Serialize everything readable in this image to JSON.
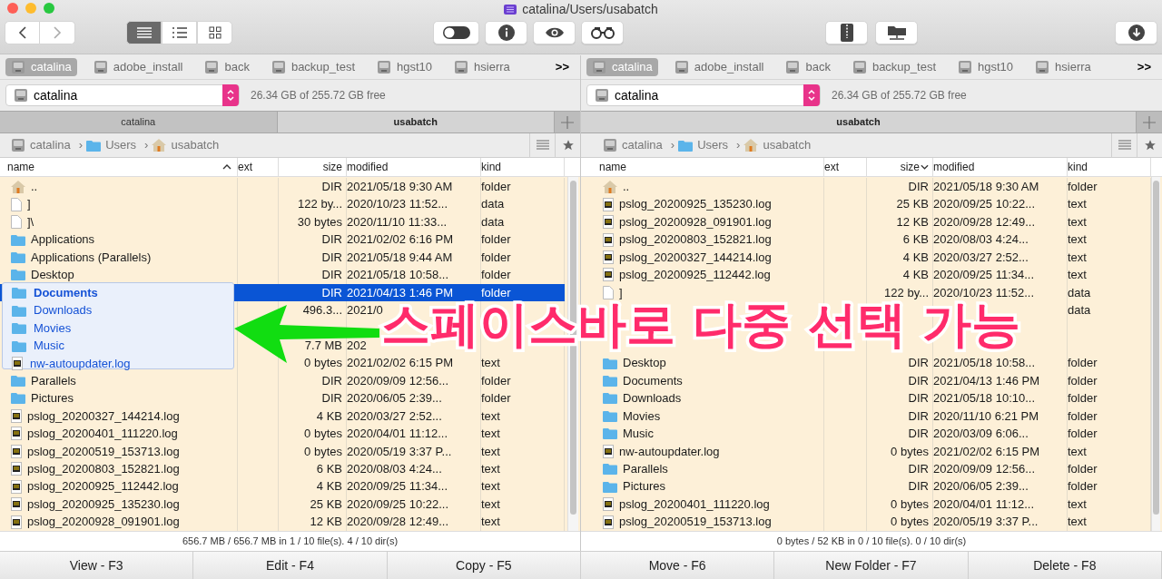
{
  "window": {
    "title": "catalina/Users/usabatch"
  },
  "toolbar": {
    "view_modes": [
      {
        "kind": "list",
        "selected": true
      },
      {
        "kind": "detail",
        "selected": false
      },
      {
        "kind": "grid",
        "selected": false
      }
    ]
  },
  "panes": [
    {
      "volumes": [
        {
          "label": "catalina",
          "selected": true
        },
        {
          "label": "adobe_install",
          "selected": false
        },
        {
          "label": "back",
          "selected": false
        },
        {
          "label": "backup_test",
          "selected": false
        },
        {
          "label": "hgst10",
          "selected": false
        },
        {
          "label": "hsierra",
          "selected": false
        }
      ],
      "volumes_more": ">>",
      "drive": "catalina",
      "free": "26.34 GB of 255.72 GB free",
      "tabs": [
        {
          "label": "catalina",
          "selected": false
        },
        {
          "label": "usabatch",
          "selected": true
        }
      ],
      "path": [
        {
          "kind": "disk",
          "label": "catalina"
        },
        {
          "kind": "folder",
          "label": "Users"
        },
        {
          "kind": "home",
          "label": "usabatch"
        }
      ],
      "separator": "›",
      "columns": [
        {
          "label": "name",
          "sorted": true,
          "descending": false
        },
        {
          "label": "ext"
        },
        {
          "label": "size"
        },
        {
          "label": "modified"
        },
        {
          "label": "kind"
        }
      ],
      "rows": [
        {
          "kind": "home",
          "name": "..",
          "size": "DIR",
          "modified": "2021/05/18 9:30 AM",
          "type": "folder",
          "selected": false
        },
        {
          "kind": "file",
          "name": "]",
          "size": "122 by...",
          "modified": "2020/10/23 11:52...",
          "type": "data",
          "selected": false
        },
        {
          "kind": "file",
          "name": "]\\",
          "size": "30 bytes",
          "modified": "2020/11/10 11:33...",
          "type": "data",
          "selected": false
        },
        {
          "kind": "folder",
          "name": "Applications",
          "size": "DIR",
          "modified": "2021/02/02 6:16 PM",
          "type": "folder",
          "selected": false
        },
        {
          "kind": "folder",
          "name": "Applications (Parallels)",
          "size": "DIR",
          "modified": "2021/05/18 9:44 AM",
          "type": "folder",
          "selected": false
        },
        {
          "kind": "folder",
          "name": "Desktop",
          "size": "DIR",
          "modified": "2021/05/18 10:58...",
          "type": "folder",
          "selected": false
        },
        {
          "kind": "none",
          "size": "DIR",
          "modified": "2021/04/13 1:46 PM",
          "type": "folder",
          "selected": true
        },
        {
          "kind": "none",
          "size": "496.3...",
          "modified": "2021/0",
          "selected": false
        },
        {
          "kind": "none",
          "selected": false
        },
        {
          "kind": "none",
          "size": "7.7 MB",
          "modified": "202",
          "selected": false
        },
        {
          "kind": "none",
          "size": "0 bytes",
          "modified": "2021/02/02 6:15 PM",
          "type": "text",
          "selected": false
        },
        {
          "kind": "folder",
          "name": "Parallels",
          "size": "DIR",
          "modified": "2020/09/09 12:56...",
          "type": "folder",
          "selected": false
        },
        {
          "kind": "folder",
          "name": "Pictures",
          "size": "DIR",
          "modified": "2020/06/05 2:39...",
          "type": "folder",
          "selected": false
        },
        {
          "kind": "log",
          "name": "pslog_20200327_144214.log",
          "size": "4 KB",
          "modified": "2020/03/27 2:52...",
          "type": "text",
          "selected": false
        },
        {
          "kind": "log",
          "name": "pslog_20200401_111220.log",
          "size": "0 bytes",
          "modified": "2020/04/01 11:12...",
          "type": "text",
          "selected": false
        },
        {
          "kind": "log",
          "name": "pslog_20200519_153713.log",
          "size": "0 bytes",
          "modified": "2020/05/19 3:37 P...",
          "type": "text",
          "selected": false
        },
        {
          "kind": "log",
          "name": "pslog_20200803_152821.log",
          "size": "6 KB",
          "modified": "2020/08/03 4:24...",
          "type": "text",
          "selected": false
        },
        {
          "kind": "log",
          "name": "pslog_20200925_112442.log",
          "size": "4 KB",
          "modified": "2020/09/25 11:34...",
          "type": "text",
          "selected": false
        },
        {
          "kind": "log",
          "name": "pslog_20200925_135230.log",
          "size": "25 KB",
          "modified": "2020/09/25 10:22...",
          "type": "text",
          "selected": false
        },
        {
          "kind": "log",
          "name": "pslog_20200928_091901.log",
          "size": "12 KB",
          "modified": "2020/09/28 12:49...",
          "type": "text",
          "selected": false
        }
      ],
      "status": "656.7 MB / 656.7 MB in 1 / 10 file(s). 4 / 10 dir(s)"
    },
    {
      "volumes": [
        {
          "label": "catalina",
          "selected": true
        },
        {
          "label": "adobe_install",
          "selected": false
        },
        {
          "label": "back",
          "selected": false
        },
        {
          "label": "backup_test",
          "selected": false
        },
        {
          "label": "hgst10",
          "selected": false
        },
        {
          "label": "hsierra",
          "selected": false
        }
      ],
      "volumes_more": ">>",
      "drive": "catalina",
      "free": "26.34 GB of 255.72 GB free",
      "tabs": [
        {
          "label": "usabatch",
          "selected": true
        }
      ],
      "path": [
        {
          "kind": "disk",
          "label": "catalina"
        },
        {
          "kind": "folder",
          "label": "Users"
        },
        {
          "kind": "home",
          "label": "usabatch"
        }
      ],
      "separator": "›",
      "columns": [
        {
          "label": "name"
        },
        {
          "label": "ext"
        },
        {
          "label": "size",
          "sorted": true,
          "descending": true
        },
        {
          "label": "modified"
        },
        {
          "label": "kind"
        }
      ],
      "rows": [
        {
          "kind": "home",
          "name": "..",
          "size": "DIR",
          "modified": "2021/05/18 9:30 AM",
          "type": "folder",
          "selected": false
        },
        {
          "kind": "log",
          "name": "pslog_20200925_135230.log",
          "size": "25 KB",
          "modified": "2020/09/25 10:22...",
          "type": "text",
          "selected": false
        },
        {
          "kind": "log",
          "name": "pslog_20200928_091901.log",
          "size": "12 KB",
          "modified": "2020/09/28 12:49...",
          "type": "text",
          "selected": false
        },
        {
          "kind": "log",
          "name": "pslog_20200803_152821.log",
          "size": "6 KB",
          "modified": "2020/08/03 4:24...",
          "type": "text",
          "selected": false
        },
        {
          "kind": "log",
          "name": "pslog_20200327_144214.log",
          "size": "4 KB",
          "modified": "2020/03/27 2:52...",
          "type": "text",
          "selected": false
        },
        {
          "kind": "log",
          "name": "pslog_20200925_112442.log",
          "size": "4 KB",
          "modified": "2020/09/25 11:34...",
          "type": "text",
          "selected": false
        },
        {
          "kind": "file",
          "name": "]",
          "size": "122 by...",
          "modified": "2020/10/23 11:52...",
          "type": "data",
          "selected": false
        },
        {
          "kind": "none",
          "type": "data",
          "selected": false
        },
        {
          "kind": "none",
          "selected": false
        },
        {
          "kind": "none",
          "selected": false
        },
        {
          "kind": "folder",
          "name": "Desktop",
          "size": "DIR",
          "modified": "2021/05/18 10:58...",
          "type": "folder",
          "selected": false
        },
        {
          "kind": "folder",
          "name": "Documents",
          "size": "DIR",
          "modified": "2021/04/13 1:46 PM",
          "type": "folder",
          "selected": false
        },
        {
          "kind": "folder",
          "name": "Downloads",
          "size": "DIR",
          "modified": "2021/05/18 10:10...",
          "type": "folder",
          "selected": false
        },
        {
          "kind": "folder",
          "name": "Movies",
          "size": "DIR",
          "modified": "2020/11/10 6:21 PM",
          "type": "folder",
          "selected": false
        },
        {
          "kind": "folder",
          "name": "Music",
          "size": "DIR",
          "modified": "2020/03/09 6:06...",
          "type": "folder",
          "selected": false
        },
        {
          "kind": "log",
          "name": "nw-autoupdater.log",
          "size": "0 bytes",
          "modified": "2021/02/02 6:15 PM",
          "type": "text",
          "selected": false
        },
        {
          "kind": "folder",
          "name": "Parallels",
          "size": "DIR",
          "modified": "2020/09/09 12:56...",
          "type": "folder",
          "selected": false
        },
        {
          "kind": "folder",
          "name": "Pictures",
          "size": "DIR",
          "modified": "2020/06/05 2:39...",
          "type": "folder",
          "selected": false
        },
        {
          "kind": "log",
          "name": "pslog_20200401_111220.log",
          "size": "0 bytes",
          "modified": "2020/04/01 11:12...",
          "type": "text",
          "selected": false
        },
        {
          "kind": "log",
          "name": "pslog_20200519_153713.log",
          "size": "0 bytes",
          "modified": "2020/05/19 3:37 P...",
          "type": "text",
          "selected": false
        }
      ],
      "status": "0 bytes / 52 KB in 0 / 10 file(s). 0 / 10 dir(s)"
    }
  ],
  "drag_list": [
    {
      "kind": "folder",
      "name": "Documents",
      "bold": true
    },
    {
      "kind": "folder",
      "name": "Downloads",
      "bold": false
    },
    {
      "kind": "folder",
      "name": "Movies",
      "bold": false
    },
    {
      "kind": "folder",
      "name": "Music",
      "bold": false
    },
    {
      "kind": "log",
      "name": "nw-autoupdater.log",
      "bold": false
    }
  ],
  "annotation": {
    "text": "스페이스바로 다중 선택 가능"
  },
  "function_keys": [
    "View - F3",
    "Edit - F4",
    "Copy - F5",
    "Move - F6",
    "New Folder - F7",
    "Delete - F8"
  ]
}
